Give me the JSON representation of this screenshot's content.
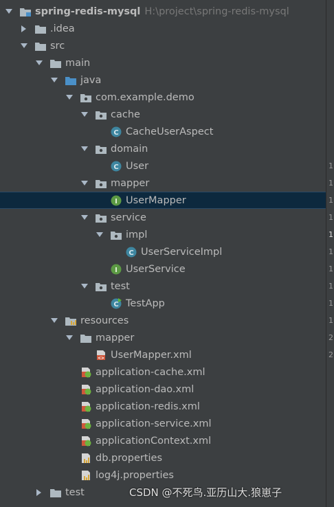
{
  "tree": {
    "project": {
      "name": "spring-redis-mysql",
      "path": "H:\\project\\spring-redis-mysql"
    },
    "items": [
      {
        "label": ".idea"
      },
      {
        "label": "src"
      },
      {
        "label": "main"
      },
      {
        "label": "java"
      },
      {
        "label": "com.example.demo"
      },
      {
        "label": "cache"
      },
      {
        "label": "CacheUserAspect"
      },
      {
        "label": "domain"
      },
      {
        "label": "User"
      },
      {
        "label": "mapper"
      },
      {
        "label": "UserMapper"
      },
      {
        "label": "service"
      },
      {
        "label": "impl"
      },
      {
        "label": "UserServiceImpl"
      },
      {
        "label": "UserService"
      },
      {
        "label": "test"
      },
      {
        "label": "TestApp"
      },
      {
        "label": "resources"
      },
      {
        "label": "mapper"
      },
      {
        "label": "UserMapper.xml"
      },
      {
        "label": "application-cache.xml"
      },
      {
        "label": "application-dao.xml"
      },
      {
        "label": "application-redis.xml"
      },
      {
        "label": "application-service.xml"
      },
      {
        "label": "applicationContext.xml"
      },
      {
        "label": "db.properties"
      },
      {
        "label": "log4j.properties"
      },
      {
        "label": "test"
      }
    ]
  },
  "gutter_marks": [
    "1",
    "1",
    "1",
    "1",
    "1",
    "1",
    "1",
    "1",
    "1",
    "1",
    "2",
    "2"
  ],
  "watermark": "CSDN @不死鸟.亚历山大.狼崽子",
  "colors": {
    "background": "#3c3f41",
    "selection": "#0d293e",
    "folder": "#aeb9c0",
    "source_folder": "#4a90c8",
    "class_icon": "#3e86a0",
    "interface_icon": "#5c9a44"
  }
}
